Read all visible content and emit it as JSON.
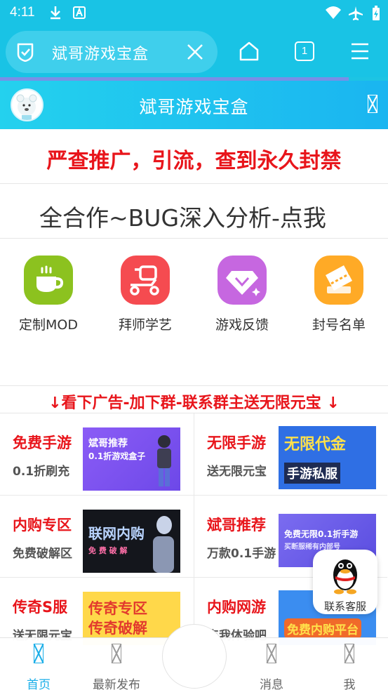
{
  "status_bar": {
    "time": "4:11",
    "left_icons": [
      "download-icon",
      "text-app-icon"
    ],
    "right_icons": [
      "wifi-icon",
      "airplane-icon",
      "battery-icon"
    ]
  },
  "browser": {
    "url_title": "斌哥游戏宝盒",
    "tab_count": "1",
    "icons": [
      "shield-check-icon",
      "close-icon",
      "home-icon",
      "tabs-icon",
      "menu-icon"
    ]
  },
  "app_header": {
    "title": "斌哥游戏宝盒"
  },
  "notice": {
    "text": "严查推广，引流，查到永久封禁"
  },
  "marquee": {
    "text": "全合作~BUG深入分析-点我"
  },
  "grid": {
    "items": [
      {
        "label": "定制MOD",
        "icon": "cup-icon",
        "color": "#8cc21f"
      },
      {
        "label": "拜师学艺",
        "icon": "scooter-icon",
        "color": "#f54b50"
      },
      {
        "label": "游戏反馈",
        "icon": "diamond-icon",
        "color": "#c667e0"
      },
      {
        "label": "封号名单",
        "icon": "ticket-icon",
        "color": "#ffaa26"
      }
    ]
  },
  "ad_banner": {
    "text": "↓看下广告-加下群-联系群主送无限元宝 ↓"
  },
  "cards": [
    {
      "title": "免费手游",
      "subtitle": "0.1折刷充",
      "image_text": [
        "斌哥推荐",
        "0.1折游戏盒子"
      ]
    },
    {
      "title": "无限手游",
      "subtitle": "送无限元宝",
      "image_text": [
        "无限代金",
        "手游私服"
      ]
    },
    {
      "title": "内购专区",
      "subtitle": "免费破解区",
      "image_text": [
        "联网内购",
        "免 费 破 解"
      ]
    },
    {
      "title": "斌哥推荐",
      "subtitle": "万款0.1手游",
      "image_text": [
        "免费无限0.1折手游",
        "买断服稀有内部号"
      ]
    },
    {
      "title": "传奇S服",
      "subtitle": "送无限元宝",
      "image_text": [
        "传奇专区",
        "传奇破解"
      ]
    },
    {
      "title": "内购网游",
      "subtitle": "点我体验吧",
      "image_text": [
        "免费内购平台"
      ]
    }
  ],
  "qq_float": {
    "label": "联系客服",
    "icon": "qq-penguin-icon"
  },
  "bottom_nav": {
    "items": [
      {
        "label": "首页",
        "active": true
      },
      {
        "label": "最新发布",
        "active": false
      },
      {
        "label": "消息",
        "active": false
      },
      {
        "label": "我",
        "active": false
      }
    ]
  },
  "colors": {
    "accent": "#19c3e5",
    "notice_red": "#e8151b",
    "nav_active": "#1aaee8"
  }
}
